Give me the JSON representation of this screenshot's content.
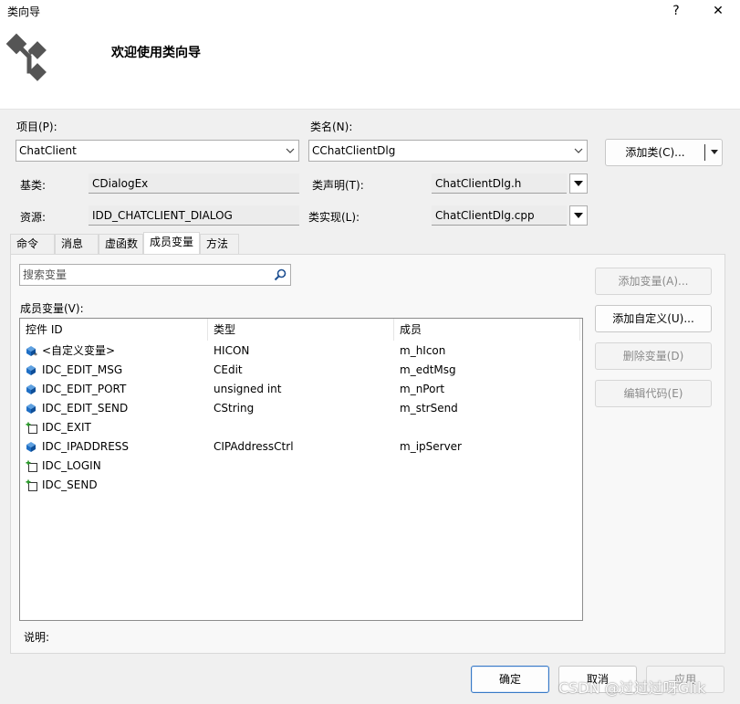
{
  "window": {
    "title": "类向导",
    "help": "?",
    "close": "✕"
  },
  "header": {
    "heading": "欢迎使用类向导",
    "logo_icon": "class-wizard-icon"
  },
  "project": {
    "label": "项目(P):",
    "value": "ChatClient"
  },
  "classname": {
    "label": "类名(N):",
    "value": "CChatClientDlg"
  },
  "add_class_button": "添加类(C)...",
  "base_class": {
    "label": "基类:",
    "value": "CDialogEx"
  },
  "resource": {
    "label": "资源:",
    "value": "IDD_CHATCLIENT_DIALOG"
  },
  "class_decl": {
    "label": "类声明(T):",
    "value": "ChatClientDlg.h"
  },
  "class_impl": {
    "label": "类实现(L):",
    "value": "ChatClientDlg.cpp"
  },
  "tabs": [
    {
      "label": "命令"
    },
    {
      "label": "消息"
    },
    {
      "label": "虚函数"
    },
    {
      "label": "成员变量",
      "active": true
    },
    {
      "label": "方法"
    }
  ],
  "search": {
    "placeholder": "搜索变量"
  },
  "member_vars_label": "成员变量(V):",
  "table": {
    "columns": [
      "控件 ID",
      "类型",
      "成员"
    ],
    "rows": [
      {
        "id": "<自定义变量>",
        "type": "HICON",
        "member": "m_hIcon",
        "icon": "custom-variable-icon"
      },
      {
        "id": "IDC_EDIT_MSG",
        "type": "CEdit",
        "member": "m_edtMsg",
        "icon": "bound-control-icon"
      },
      {
        "id": "IDC_EDIT_PORT",
        "type": "unsigned int",
        "member": "m_nPort",
        "icon": "bound-control-icon"
      },
      {
        "id": "IDC_EDIT_SEND",
        "type": "CString",
        "member": "m_strSend",
        "icon": "bound-control-icon"
      },
      {
        "id": "IDC_EXIT",
        "type": "",
        "member": "",
        "icon": "control-add-icon"
      },
      {
        "id": "IDC_IPADDRESS",
        "type": "CIPAddressCtrl",
        "member": "m_ipServer",
        "icon": "bound-control-icon"
      },
      {
        "id": "IDC_LOGIN",
        "type": "",
        "member": "",
        "icon": "control-add-icon"
      },
      {
        "id": "IDC_SEND",
        "type": "",
        "member": "",
        "icon": "control-add-icon"
      }
    ]
  },
  "side_buttons": {
    "add_variable": "添加变量(A)...",
    "add_custom": "添加自定义(U)...",
    "delete_variable": "删除变量(D)",
    "edit_code": "编辑代码(E)"
  },
  "description_label": "说明:",
  "footer": {
    "ok": "确定",
    "cancel": "取消",
    "apply": "应用"
  },
  "watermark": "CSDN @过过过呀Glik"
}
